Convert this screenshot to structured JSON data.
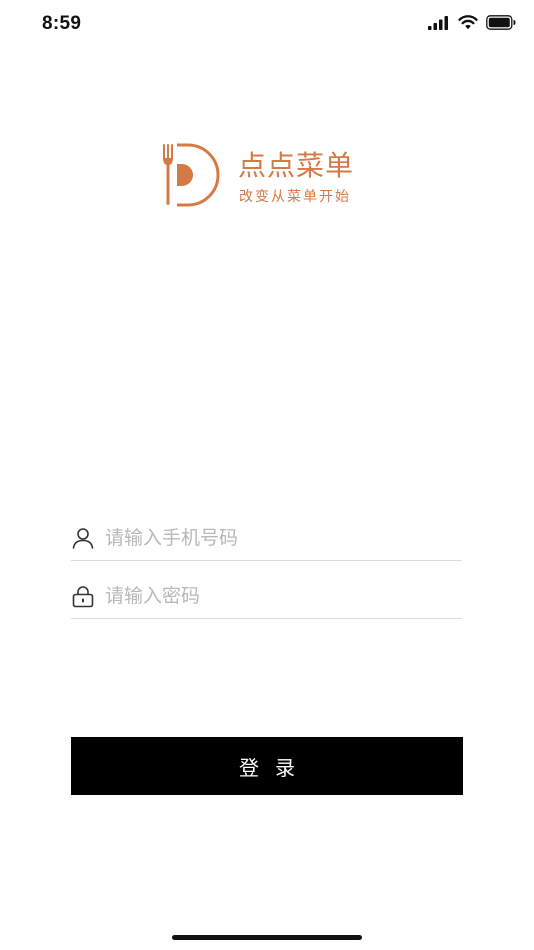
{
  "status_bar": {
    "time": "8:59",
    "icons": [
      "cellular-signal-icon",
      "wifi-icon",
      "battery-icon"
    ]
  },
  "logo": {
    "name": "点点菜单",
    "slogan": "改变从菜单开始",
    "color": "#d47a45"
  },
  "form": {
    "phone": {
      "icon": "user-icon",
      "value": "",
      "placeholder": "请输入手机号码"
    },
    "password": {
      "icon": "lock-icon",
      "value": "",
      "placeholder": "请输入密码"
    },
    "login_label": "登录"
  },
  "colors": {
    "accent": "#d47a45",
    "button_bg": "#000000",
    "button_text": "#ffffff",
    "placeholder": "#b8b8b8",
    "divider": "#dcdcdc"
  }
}
